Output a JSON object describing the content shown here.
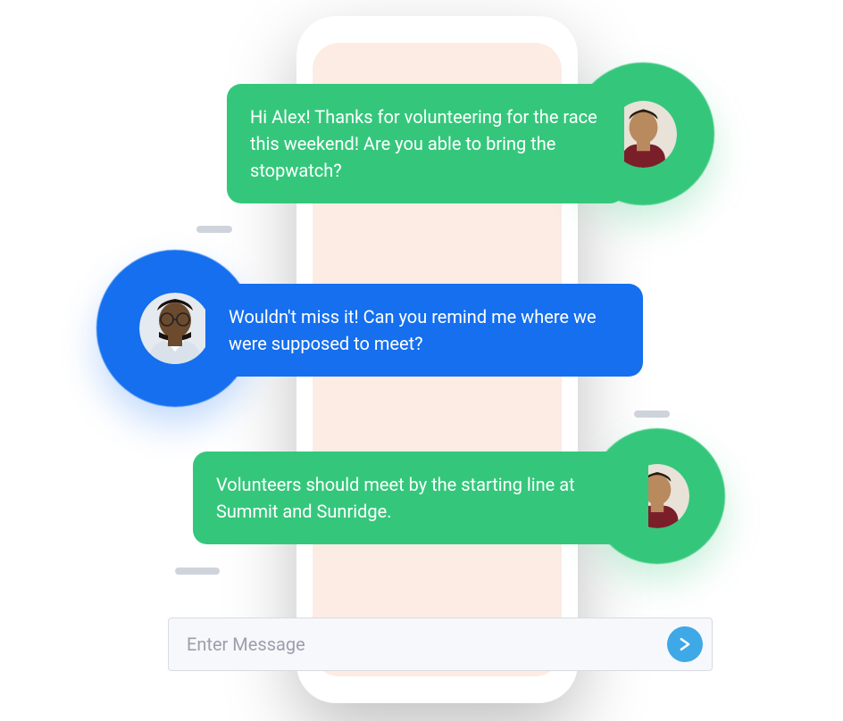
{
  "messages": [
    {
      "sender": "organizer",
      "text": "Hi Alex! Thanks for volunteering for the race this weekend! Are you able to bring the stopwatch?",
      "color": "green"
    },
    {
      "sender": "alex",
      "text": "Wouldn't miss it! Can you remind me where we were supposed to meet?",
      "color": "blue"
    },
    {
      "sender": "organizer",
      "text": "Volunteers should meet by the starting line at Summit and Sunridge.",
      "color": "green"
    }
  ],
  "composer": {
    "placeholder": "Enter Message",
    "value": ""
  },
  "colors": {
    "green": "#34c77b",
    "blue": "#156fee",
    "send": "#3fa8e6",
    "phone_bg": "#fcece3"
  }
}
